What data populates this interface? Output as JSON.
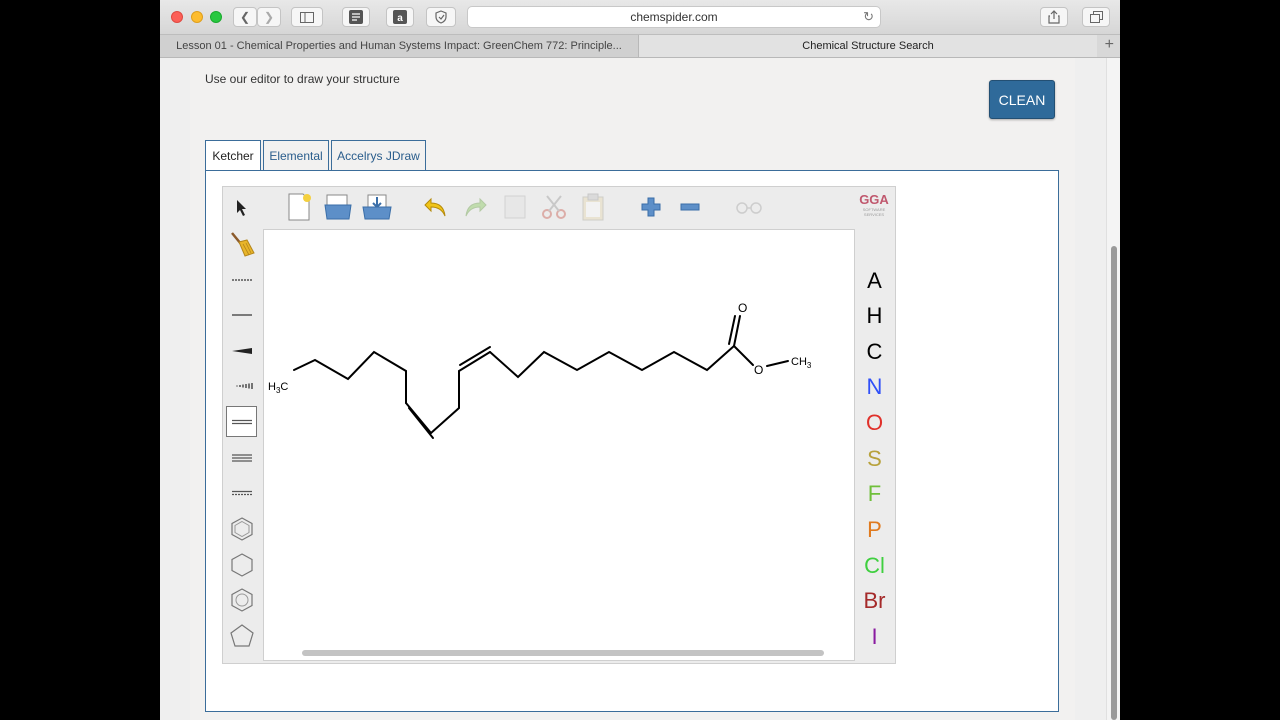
{
  "browser": {
    "url": "chemspider.com",
    "tabs": [
      {
        "label": "Lesson 01 - Chemical Properties and Human Systems Impact: GreenChem 772: Principle..."
      },
      {
        "label": "Chemical Structure Search"
      }
    ]
  },
  "page": {
    "hint": "Use our editor to draw your structure",
    "clean_label": "CLEAN",
    "editor_tabs": [
      {
        "label": "Ketcher"
      },
      {
        "label": "Elemental"
      },
      {
        "label": "Accelrys JDraw"
      }
    ]
  },
  "ketcher": {
    "logo": {
      "main": "GGA",
      "sub1": "SOFTWARE",
      "sub2": "SERVICES"
    },
    "elements": [
      {
        "symbol": "A",
        "color": "#000000"
      },
      {
        "symbol": "H",
        "color": "#000000"
      },
      {
        "symbol": "C",
        "color": "#000000"
      },
      {
        "symbol": "N",
        "color": "#3050f8"
      },
      {
        "symbol": "O",
        "color": "#e0302a"
      },
      {
        "symbol": "S",
        "color": "#b8a23c"
      },
      {
        "symbol": "F",
        "color": "#6fbf3a"
      },
      {
        "symbol": "P",
        "color": "#e07a1f"
      },
      {
        "symbol": "Cl",
        "color": "#3fcf3f"
      },
      {
        "symbol": "Br",
        "color": "#a52a2a"
      },
      {
        "symbol": "I",
        "color": "#8a1ba0"
      }
    ],
    "molecule_labels": {
      "left_methyl": "H3C",
      "carbonyl_o": "O",
      "ester_o": "O",
      "right_methyl": "CH3"
    }
  }
}
